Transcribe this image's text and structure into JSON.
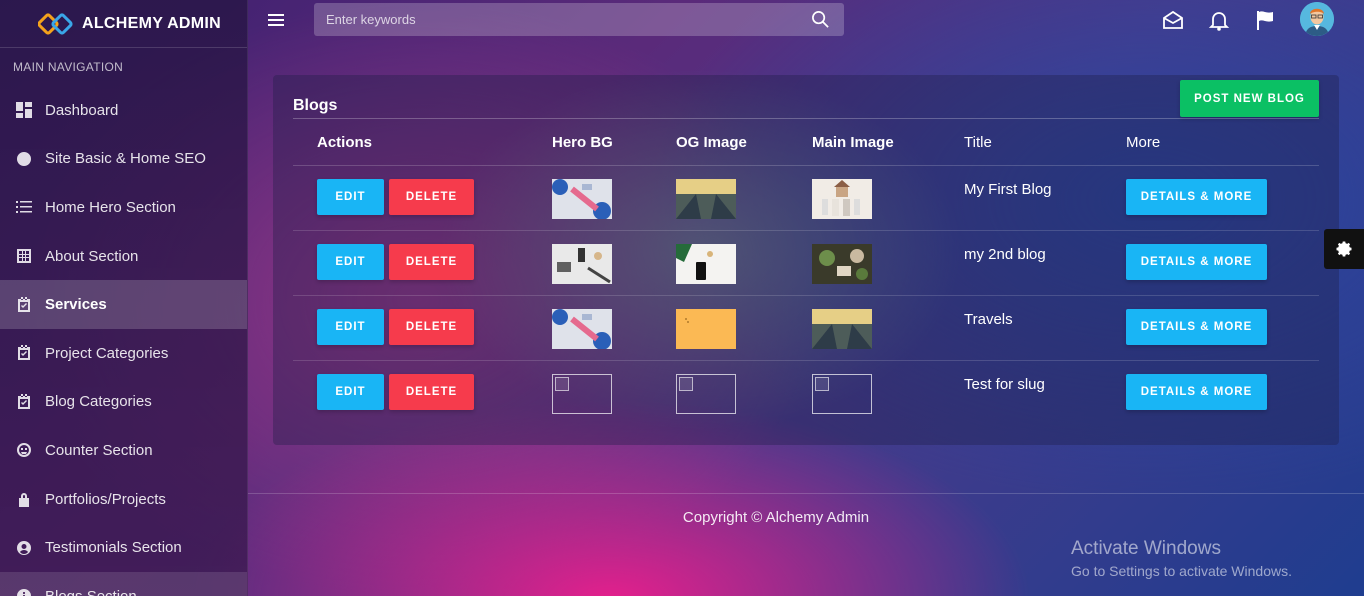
{
  "brand": {
    "name": "ALCHEMY ADMIN",
    "logo_icon": "chain-link-logo"
  },
  "sidebar": {
    "heading": "MAIN NAVIGATION",
    "items": [
      {
        "label": "Dashboard",
        "icon": "dashboard-icon"
      },
      {
        "label": "Site Basic & Home SEO",
        "icon": "contrast-icon"
      },
      {
        "label": "Home Hero Section",
        "icon": "list-icon"
      },
      {
        "label": "About Section",
        "icon": "grid-icon"
      },
      {
        "label": "Services",
        "icon": "calendar-check-icon",
        "active": true
      },
      {
        "label": "Project Categories",
        "icon": "calendar-check-icon"
      },
      {
        "label": "Blog Categories",
        "icon": "calendar-check-icon"
      },
      {
        "label": "Counter Section",
        "icon": "smile-icon"
      },
      {
        "label": "Portfolios/Projects",
        "icon": "lock-icon"
      },
      {
        "label": "Testimonials Section",
        "icon": "user-circle-icon"
      },
      {
        "label": "Blogs Section",
        "icon": "info-icon"
      }
    ]
  },
  "topbar": {
    "search_placeholder": "Enter keywords",
    "icons": [
      "mail-icon",
      "bell-icon",
      "flag-icon"
    ]
  },
  "card": {
    "title": "Blogs",
    "post_button": "POST NEW BLOG",
    "columns": [
      "Actions",
      "Hero BG",
      "OG Image",
      "Main Image",
      "Title",
      "More"
    ],
    "edit_label": "EDIT",
    "delete_label": "DELETE",
    "more_label": "DETAILS & MORE",
    "rows": [
      {
        "title": "My First Blog"
      },
      {
        "title": "my 2nd blog"
      },
      {
        "title": "Travels"
      },
      {
        "title": "Test for slug"
      }
    ]
  },
  "footer": {
    "copyright": "Copyright © Alchemy Admin"
  },
  "watermark": {
    "title": "Activate Windows",
    "subtitle": "Go to Settings to activate Windows."
  },
  "colors": {
    "success": "#0bc064",
    "info": "#19b5f5",
    "danger": "#f63b4c"
  }
}
